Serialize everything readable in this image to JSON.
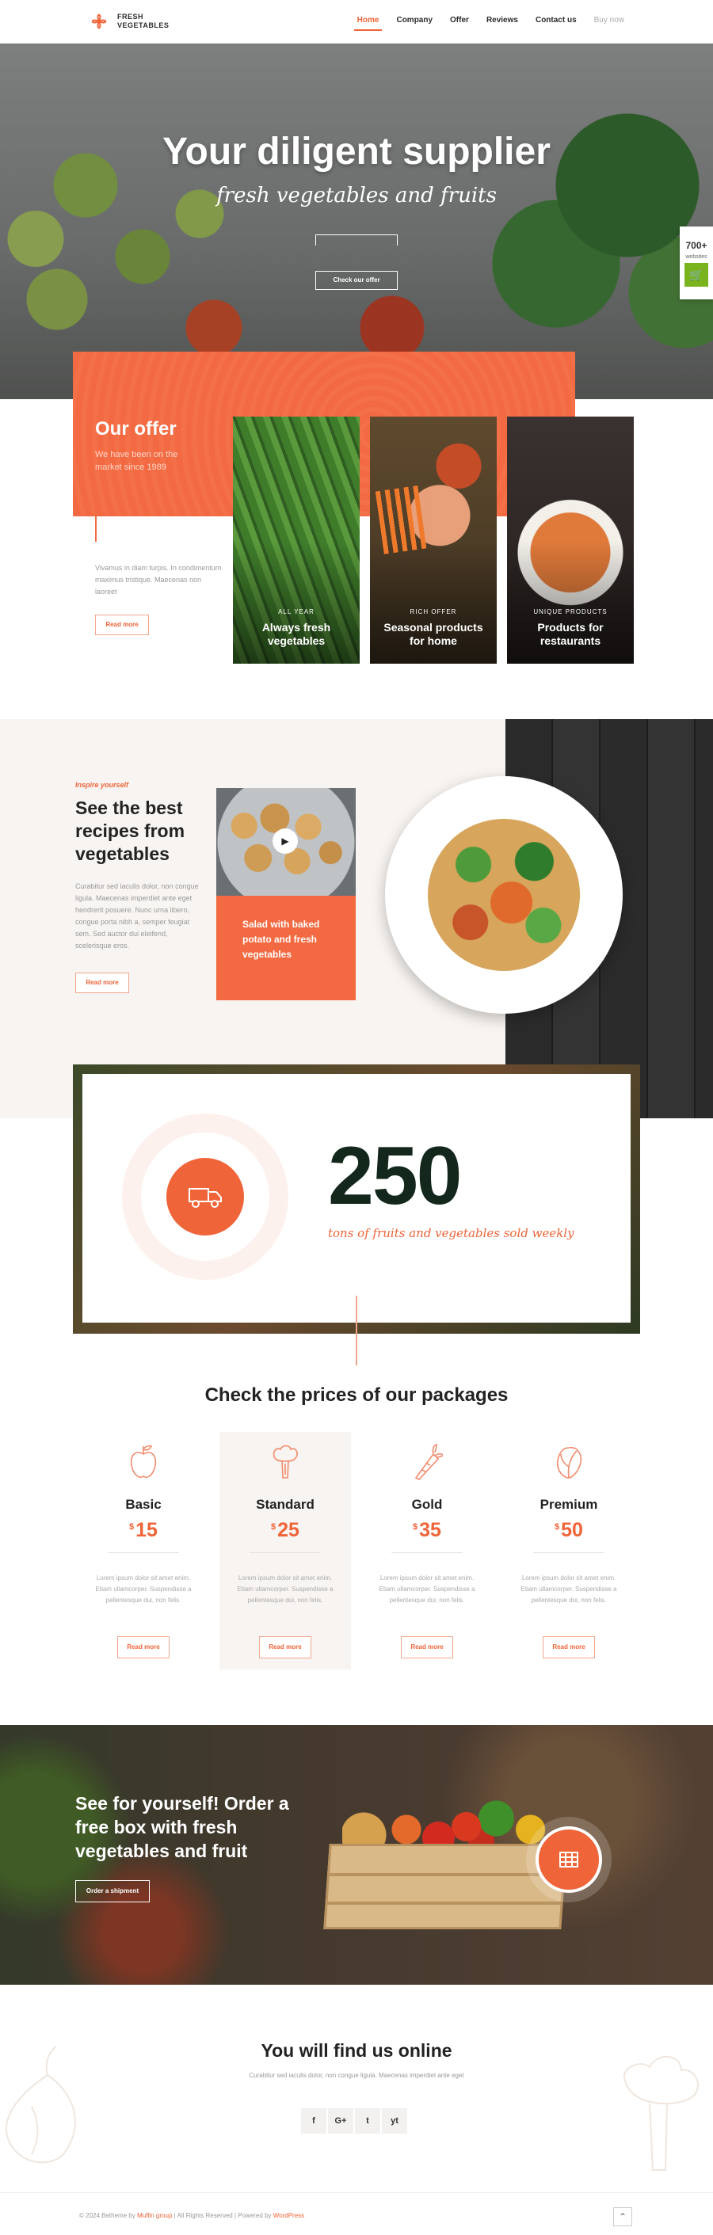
{
  "brand": {
    "line1": "FRESH",
    "line2": "VEGETABLES",
    "color": "#ef6438"
  },
  "nav": [
    "Home",
    "Company",
    "Offer",
    "Reviews",
    "Contact us",
    "Buy now"
  ],
  "hero": {
    "title": "Your diligent supplier",
    "subtitle": "fresh vegetables and fruits",
    "button": "Check our offer",
    "badge_count": "700+",
    "badge_label": "websites",
    "badge_cart": "Buy now"
  },
  "offer": {
    "title": "Our offer",
    "subtitle": "We have been on the market since 1989",
    "text": "Vivamus in diam turpis. In condimentum maximus tristique. Maecenas non laoreet",
    "button": "Read more",
    "cards": [
      {
        "tag": "ALL YEAR",
        "name": "Always fresh vegetables"
      },
      {
        "tag": "RICH OFFER",
        "name": "Seasonal products for home"
      },
      {
        "tag": "UNIQUE PRODUCTS",
        "name": "Products for restaurants"
      }
    ]
  },
  "recipes": {
    "kicker": "Inspire yourself",
    "title": "See the best recipes from vegetables",
    "text": "Curabitur sed iaculis dolor, non congue ligula. Maecenas imperdiet ante eget hendrerit posuere. Nunc urna libero, congue porta nibh a, semper feugiat sem. Sed auctor dui eleifend, scelerisque eros.",
    "button": "Read more",
    "box": "Salad with baked potato and fresh vegetables"
  },
  "stats": {
    "number": "250",
    "label": "tons of fruits and vegetables sold weekly"
  },
  "prices": {
    "title": "Check the prices of our packages",
    "plans": [
      {
        "name": "Basic",
        "currency": "$",
        "amount": "15",
        "icon": "apple-icon",
        "desc": "Lorem ipsum dolor sit amet enim. Etiam ullamcorper. Suspendisse a pellentesque dui, non felis.",
        "button": "Read more"
      },
      {
        "name": "Standard",
        "currency": "$",
        "amount": "25",
        "icon": "broccoli-icon",
        "desc": "Lorem ipsum dolor sit amet enim. Etiam ullamcorper. Suspendisse a pellentesque dui, non felis.",
        "button": "Read more"
      },
      {
        "name": "Gold",
        "currency": "$",
        "amount": "35",
        "icon": "carrot-icon",
        "desc": "Lorem ipsum dolor sit amet enim. Etiam ullamcorper. Suspendisse a pellentesque dui, non felis.",
        "button": "Read more"
      },
      {
        "name": "Premium",
        "currency": "$",
        "amount": "50",
        "icon": "cabbage-icon",
        "desc": "Lorem ipsum dolor sit amet enim. Etiam ullamcorper. Suspendisse a pellentesque dui, non felis.",
        "button": "Read more"
      }
    ]
  },
  "cta": {
    "title": "See for yourself! Order a free box with fresh vegetables and fruit",
    "button": "Order a shipment"
  },
  "online": {
    "title": "You will find us online",
    "subtitle": "Curabitur sed iaculis dolor, non congue ligula. Maecenas imperdiet ante eget",
    "social": [
      "f",
      "G+",
      "t",
      "yt"
    ]
  },
  "footer": {
    "prefix": "© 2024 Betheme by",
    "company": "Muffin group",
    "middle": "| All Rights Reserved | Powered by",
    "powered": "WordPress"
  }
}
